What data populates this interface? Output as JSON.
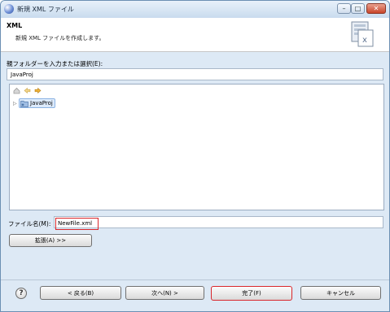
{
  "window": {
    "title": "新規 XML ファイル",
    "minimize_glyph": "–",
    "maximize_glyph": "□",
    "close_glyph": "✕"
  },
  "header": {
    "title": "XML",
    "description": "新規 XML ファイルを作成します。"
  },
  "folder": {
    "label": "親フォルダーを入力または選択(E):",
    "value": "JavaProj"
  },
  "tree": {
    "items": [
      {
        "label": "JavaProj",
        "expanded": false,
        "selected": true
      }
    ]
  },
  "file": {
    "label": "ファイル名(M):",
    "value": "NewFile.xml"
  },
  "advanced_button": "拡張(A) >>",
  "footer": {
    "help": "?",
    "back": "< 戻る(B)",
    "next": "次へ(N) >",
    "finish": "完了(F)",
    "cancel": "キャンセル"
  },
  "colors": {
    "highlight_border": "#d9262b",
    "dialog_background": "#dde9f5",
    "selection_fill": "#dceafb"
  }
}
